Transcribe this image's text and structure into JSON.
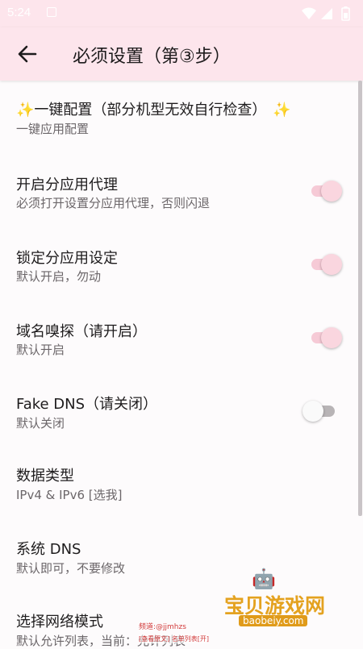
{
  "status_bar": {
    "time": "5:24",
    "icons": [
      "notification-icon",
      "wifi-icon",
      "signal-icon",
      "battery-icon"
    ]
  },
  "toolbar": {
    "back_icon": "arrow-left-icon",
    "title": "必须设置（第③步）"
  },
  "settings": [
    {
      "title": "一键配置（部分机型无效自行检查）",
      "subtitle": "一键应用配置",
      "icon": "sparkles-icon"
    },
    {
      "title": "开启分应用代理",
      "subtitle": "必须打开设置分应用代理，否则闪退",
      "switch_on": true
    },
    {
      "title": "锁定分应用设定",
      "subtitle": "默认开启，勿动",
      "switch_on": true
    },
    {
      "title": "域名嗅探（请开启）",
      "subtitle": "默认开启",
      "switch_on": true
    },
    {
      "title": "Fake DNS（请关闭）",
      "subtitle": "默认关闭",
      "switch_on": false
    },
    {
      "title": "数据类型",
      "subtitle": "IPv4 & IPv6 [选我]"
    },
    {
      "title": "系统 DNS",
      "subtitle": "默认即可，不要修改"
    },
    {
      "title": "选择网络模式",
      "subtitle": "默认允许列表，当前：允许列表"
    }
  ],
  "watermark": {
    "site_name": "宝贝游戏网",
    "url": "baobeiy.com",
    "credit_line1": "频道:@jjmhzs",
    "credit_line2": "[查看原文] 名单列表[开]"
  },
  "colors": {
    "header_bg": "#fde5ec",
    "switch_on_track": "#f6cad6",
    "switch_on_thumb": "#fad6df",
    "switch_off_track": "#b8b4b6",
    "watermark_orange": "#e4a21f"
  }
}
